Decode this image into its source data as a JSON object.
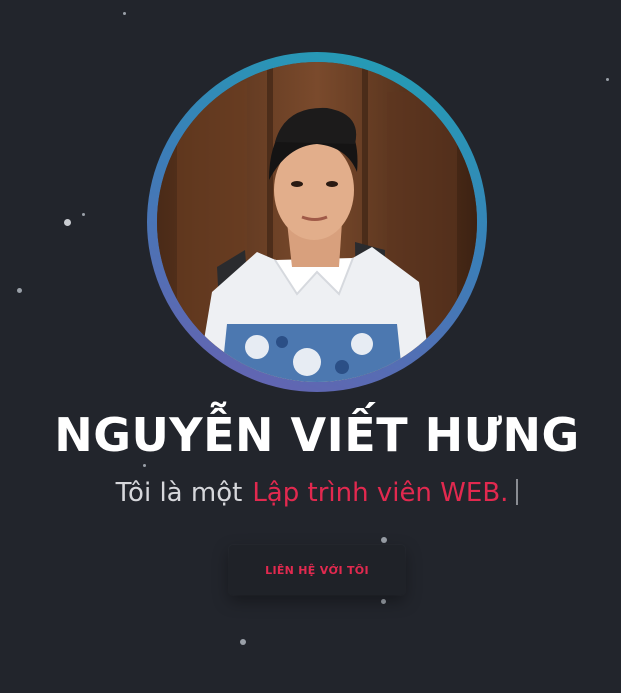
{
  "profile": {
    "name": "NGUYỄN VIẾT HƯNG",
    "intro": "Tôi là một",
    "role": "Lập trình viên WEB."
  },
  "cta": {
    "label": "LIÊN HỆ VỚI TÔI"
  },
  "colors": {
    "background": "#22252c",
    "accent": "#e2294f",
    "ring_start": "#1fa3b4",
    "ring_end": "#6b5fb0"
  },
  "images": {
    "avatar": "profile-photo"
  }
}
